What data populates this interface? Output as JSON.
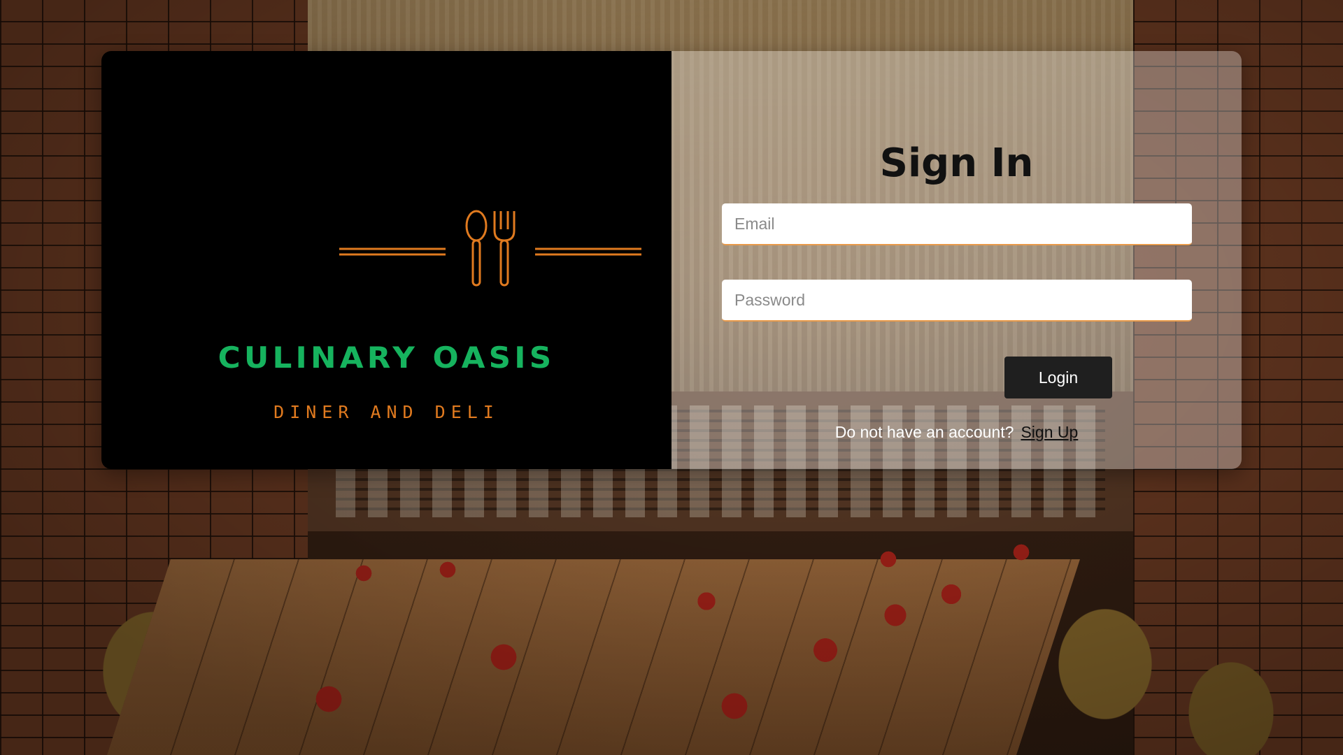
{
  "brand": {
    "name": "CULINARY OASIS",
    "tagline": "DINER AND DELI",
    "name_color": "#16b35e",
    "accent_color": "#e07a1f"
  },
  "form": {
    "title": "Sign In",
    "email_placeholder": "Email",
    "password_placeholder": "Password",
    "login_label": "Login",
    "signup_prompt": "Do not have an account?",
    "signup_link": "Sign Up"
  },
  "icons": {
    "logo": "spoon-and-fork-icon"
  }
}
